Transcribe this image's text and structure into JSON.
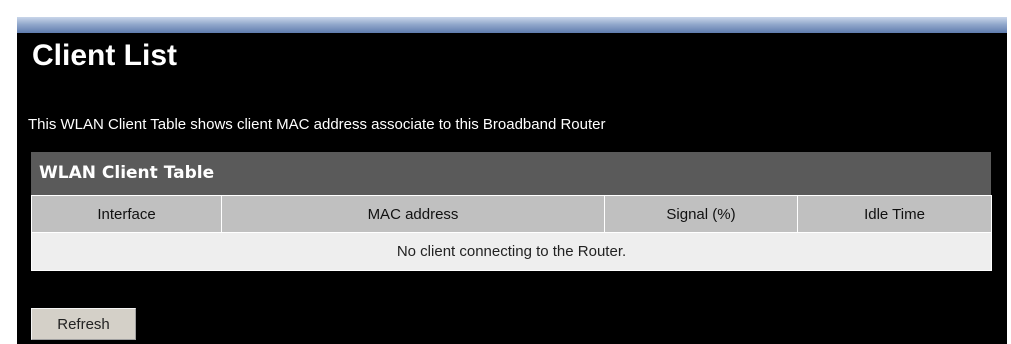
{
  "page": {
    "title": "Client List",
    "description": "This WLAN Client Table shows client MAC address associate to this Broadband Router"
  },
  "table": {
    "title": "WLAN Client Table",
    "columns": [
      "Interface",
      "MAC address",
      "Signal (%)",
      "Idle Time"
    ],
    "empty_message": "No client connecting to the Router."
  },
  "actions": {
    "refresh_label": "Refresh"
  },
  "colors": {
    "background": "#000000",
    "top_bar": "#7f97c1",
    "table_title_bg": "#5a5a5a",
    "column_header_bg": "#c0c0c0",
    "row_bg": "#eeeeee"
  }
}
